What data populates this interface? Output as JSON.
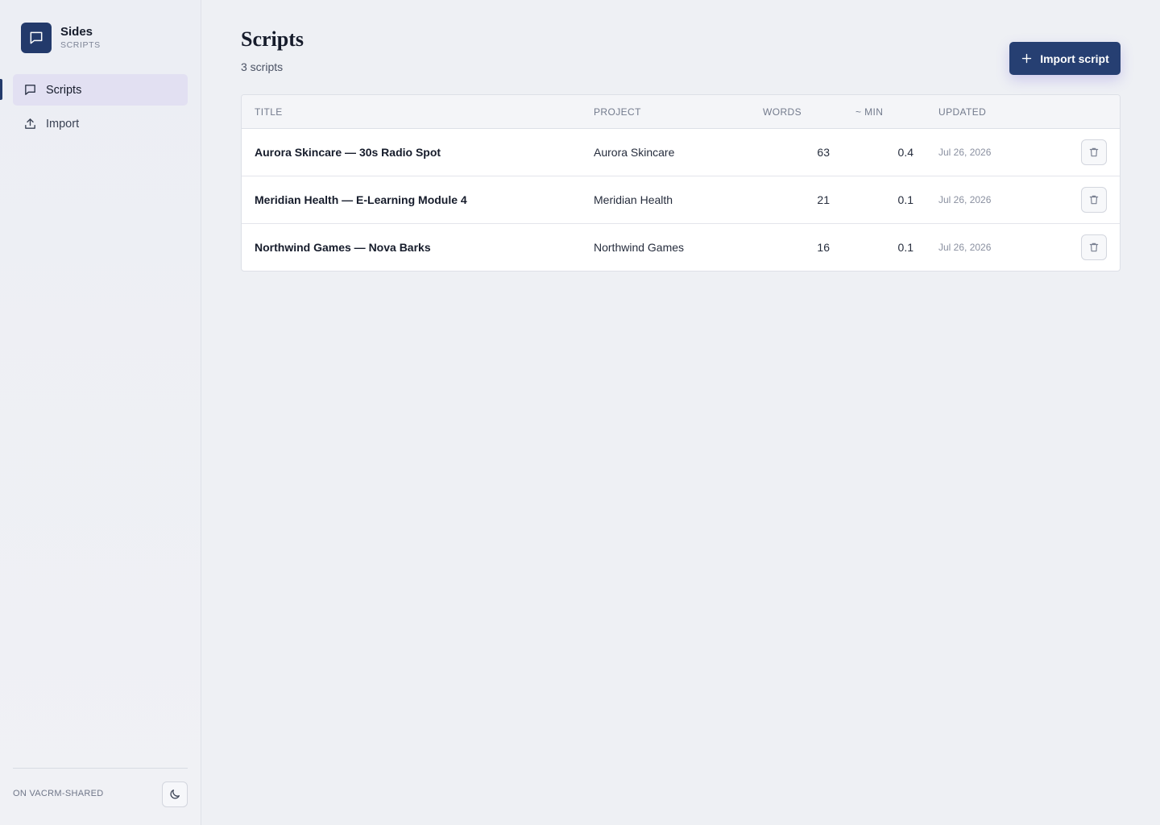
{
  "brand": {
    "name": "Sides",
    "subtitle": "SCRIPTS",
    "icon": "message-square-icon"
  },
  "nav": [
    {
      "label": "Scripts",
      "icon": "message-square-icon",
      "active": true
    },
    {
      "label": "Import",
      "icon": "upload-icon",
      "active": false
    }
  ],
  "sidebar_footer": {
    "workspace": "ON VACRM-SHARED",
    "theme_icon": "moon-icon"
  },
  "header": {
    "title": "Scripts",
    "count": "3 scripts",
    "import_label": "Import script",
    "import_icon": "plus-icon"
  },
  "table": {
    "columns": [
      "TITLE",
      "PROJECT",
      "WORDS",
      "~ MIN",
      "UPDATED"
    ],
    "rows": [
      {
        "title": "Aurora Skincare — 30s Radio Spot",
        "project": "Aurora Skincare",
        "words": "63",
        "min": "0.4",
        "updated": "Jul 26, 2026"
      },
      {
        "title": "Meridian Health — E-Learning Module 4",
        "project": "Meridian Health",
        "words": "21",
        "min": "0.1",
        "updated": "Jul 26, 2026"
      },
      {
        "title": "Northwind Games — Nova Barks",
        "project": "Northwind Games",
        "words": "16",
        "min": "0.1",
        "updated": "Jul 26, 2026"
      }
    ],
    "row_action_icon": "trash-icon"
  },
  "colors": {
    "accent": "#263f72",
    "active_nav": "#e2e0f2",
    "background": "#eef0f4"
  }
}
